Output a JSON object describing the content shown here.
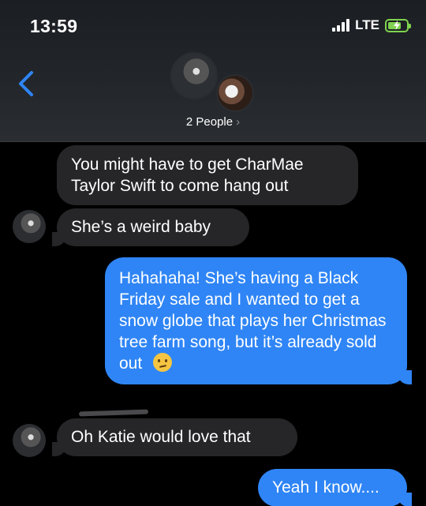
{
  "status_bar": {
    "time": "13:59",
    "network": "LTE"
  },
  "header": {
    "participants_label": "2 People",
    "chevron": "›"
  },
  "messages": [
    {
      "sender": "them",
      "text": "You might have to get CharMae Taylor Swift to come hang out"
    },
    {
      "sender": "them",
      "text": "She’s a weird baby"
    },
    {
      "sender": "me",
      "text": "Hahahaha! She’s having a Black Friday sale and I wanted to get a snow globe that plays her Christmas tree farm song, but it’s already sold out",
      "emoji": "confused-face"
    },
    {
      "sender": "them",
      "text": "Oh Katie would love that"
    },
    {
      "sender": "me",
      "text": "Yeah I know...."
    }
  ],
  "colors": {
    "outgoing": "#2f85f5",
    "incoming": "#262628",
    "back": "#2f85f5",
    "battery": "#7fd34e"
  },
  "icons": {
    "back": "chevron-left-icon",
    "battery": "battery-charging-icon",
    "signal": "cellular-signal-icon"
  },
  "battery_level": 0.6
}
